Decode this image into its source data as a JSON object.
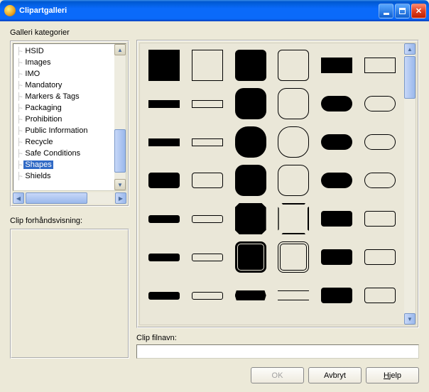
{
  "window": {
    "title": "Clipartgalleri"
  },
  "labels": {
    "categories": "Galleri kategorier",
    "preview": "Clip forhåndsvisning:",
    "filename": "Clip filnavn:"
  },
  "tree": {
    "items": [
      "HSID",
      "Images",
      "IMO",
      "Mandatory",
      "Markers & Tags",
      "Packaging",
      "Prohibition",
      "Public Information",
      "Recycle",
      "Safe Conditions",
      "Shapes",
      "Shields"
    ],
    "selected": "Shapes"
  },
  "filename_value": "",
  "buttons": {
    "ok": "OK",
    "cancel": "Avbryt",
    "help": "Hjelp",
    "help_u": "H"
  }
}
